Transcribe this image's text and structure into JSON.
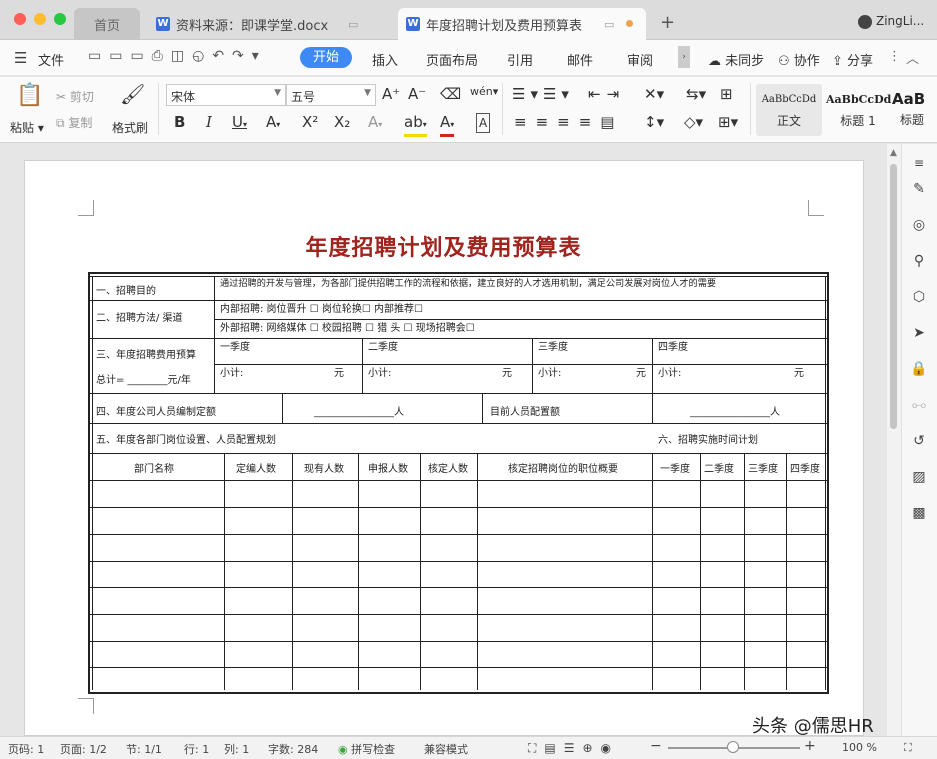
{
  "window": {
    "tabs": [
      {
        "label": "首页"
      },
      {
        "label": "资料来源：即课学堂.docx"
      },
      {
        "label": "年度招聘计划及费用预算表"
      }
    ],
    "user": "ZingLi..."
  },
  "menu": {
    "file": "文件",
    "items": [
      "开始",
      "插入",
      "页面布局",
      "引用",
      "邮件",
      "审阅"
    ],
    "right": [
      "未同步",
      "协作",
      "分享"
    ]
  },
  "ribbon": {
    "paste": "粘贴",
    "cut": "剪切",
    "copy": "复制",
    "format_painter": "格式刷",
    "font_name": "宋体",
    "font_size": "五号",
    "styles": [
      {
        "preview": "AaBbCcDd",
        "name": "正文"
      },
      {
        "preview": "AaBbCcDd",
        "name": "标题 1"
      },
      {
        "preview": "AaB",
        "name": "标题"
      }
    ]
  },
  "document": {
    "title": "年度招聘计划及费用预算表",
    "r1_label": "一、招聘目的",
    "r1_text": "通过招聘的开发与管理，为各部门提供招聘工作的流程和依据，建立良好的人才选用机制，满足公司发展对岗位人才的需要",
    "r2_label": "二、招聘方法/ 渠道",
    "r2_internal": "内部招聘:    岗位晋升 ☐          岗位轮换☐          内部推荐☐",
    "r2_external": "外部招聘:    网络媒体 ☐       校园招聘  ☐        猎     头 ☐     现场招聘会☐",
    "r3_label": "三、年度招聘费用预算",
    "r3_total": "总计=  ________元/年",
    "quarters": [
      "一季度",
      "二季度",
      "三季度",
      "四季度"
    ],
    "subtotal": "小计:",
    "yuan": "元",
    "r4_label": "四、年度公司人员编制定额",
    "r4_blank": "________________人",
    "r4_current": "目前人员配置额",
    "r4_blank2": "________________人",
    "r5_label": "五、年度各部门岗位设置、人员配置规划",
    "r6_label": "六、招聘实施时间计划",
    "headers": [
      "部门名称",
      "定编人数",
      "现有人数",
      "申报人数",
      "核定人数",
      "核定招聘岗位的职位概要",
      "一季度",
      "二季度",
      "三季度",
      "四季度"
    ]
  },
  "status": {
    "page_num": "页码: 1",
    "pages": "页面: 1/2",
    "section": "节: 1/1",
    "row": "行: 1",
    "col": "列: 1",
    "words": "字数: 284",
    "spell": "拼写检查",
    "compat": "兼容模式",
    "zoom": "100 %"
  },
  "watermark": "头条 @儒思HR"
}
